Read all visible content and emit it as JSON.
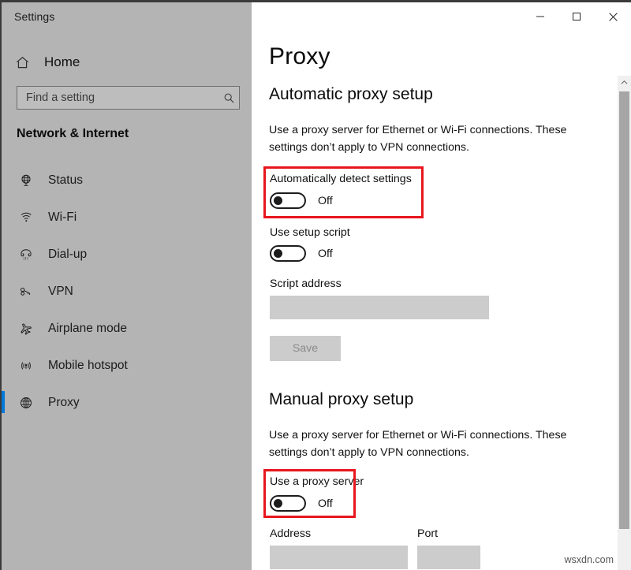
{
  "window": {
    "app_title": "Settings",
    "controls": {
      "minimize": "minimize-button",
      "maximize": "maximize-button",
      "close": "close-button"
    }
  },
  "sidebar": {
    "home_label": "Home",
    "home_icon": "home-icon",
    "search": {
      "placeholder": "Find a setting",
      "value": "",
      "icon": "search-icon"
    },
    "category": "Network & Internet",
    "items": [
      {
        "label": "Status",
        "icon": "globe-stand-icon",
        "selected": false
      },
      {
        "label": "Wi-Fi",
        "icon": "wifi-icon",
        "selected": false
      },
      {
        "label": "Dial-up",
        "icon": "telephone-icon",
        "selected": false
      },
      {
        "label": "VPN",
        "icon": "key-icon",
        "selected": false
      },
      {
        "label": "Airplane mode",
        "icon": "airplane-icon",
        "selected": false
      },
      {
        "label": "Mobile hotspot",
        "icon": "broadcast-tower-icon",
        "selected": false
      },
      {
        "label": "Proxy",
        "icon": "globe-icon",
        "selected": true
      }
    ]
  },
  "main": {
    "page_title": "Proxy",
    "automatic_section": {
      "heading": "Automatic proxy setup",
      "description": "Use a proxy server for Ethernet or Wi-Fi connections. These settings don’t apply to VPN connections.",
      "auto_detect": {
        "label": "Automatically detect settings",
        "state": "Off",
        "highlighted": true
      },
      "setup_script": {
        "label": "Use setup script",
        "state": "Off",
        "highlighted": false
      },
      "script_address": {
        "label": "Script address",
        "value": "",
        "placeholder": ""
      },
      "save_label": "Save",
      "save_enabled": false
    },
    "manual_section": {
      "heading": "Manual proxy setup",
      "description": "Use a proxy server for Ethernet or Wi-Fi connections. These settings don’t apply to VPN connections.",
      "use_proxy": {
        "label": "Use a proxy server",
        "state": "Off",
        "highlighted": true
      },
      "address": {
        "label": "Address",
        "value": "",
        "placeholder": ""
      },
      "port": {
        "label": "Port",
        "value": "",
        "placeholder": ""
      }
    },
    "scrollbar": {
      "up_arrow": "chevron-up-icon"
    }
  },
  "watermark": "wsxdn.com",
  "colors": {
    "accent": "#0078d7",
    "annotation": "#e8161d",
    "sidebar_bg": "#b4b4b4",
    "input_bg": "#cccccc"
  }
}
